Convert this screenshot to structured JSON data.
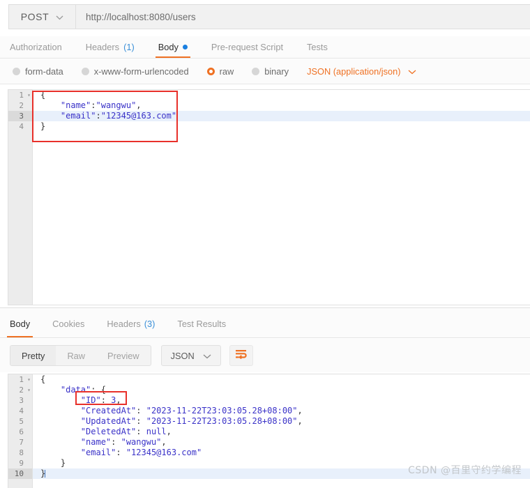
{
  "request": {
    "method": "POST",
    "method_caret_icon": "chevron-down-icon",
    "url": "http://localhost:8080/users",
    "tabs": [
      {
        "label": "Authorization",
        "count": "",
        "active": false,
        "dot": false
      },
      {
        "label": "Headers",
        "count": "(1)",
        "active": false,
        "dot": false
      },
      {
        "label": "Body",
        "count": "",
        "active": true,
        "dot": true
      },
      {
        "label": "Pre-request Script",
        "count": "",
        "active": false,
        "dot": false
      },
      {
        "label": "Tests",
        "count": "",
        "active": false,
        "dot": false
      }
    ],
    "body_types": [
      {
        "label": "form-data",
        "selected": false
      },
      {
        "label": "x-www-form-urlencoded",
        "selected": false
      },
      {
        "label": "raw",
        "selected": true
      },
      {
        "label": "binary",
        "selected": false
      }
    ],
    "content_type": "JSON (application/json)",
    "content_type_caret_icon": "chevron-down-icon",
    "body_lines": [
      {
        "n": "1",
        "fold": "▾",
        "text": "{",
        "highlight": false,
        "gutter_active": false
      },
      {
        "n": "2",
        "fold": "",
        "text": "    \"name\":\"wangwu\",",
        "highlight": false,
        "gutter_active": false
      },
      {
        "n": "3",
        "fold": "",
        "text": "    \"email\":\"12345@163.com\"",
        "highlight": true,
        "gutter_active": true
      },
      {
        "n": "4",
        "fold": "",
        "text": "}",
        "highlight": false,
        "gutter_active": false
      }
    ]
  },
  "response": {
    "tabs": [
      {
        "label": "Body",
        "count": "",
        "active": true
      },
      {
        "label": "Cookies",
        "count": "",
        "active": false
      },
      {
        "label": "Headers",
        "count": "(3)",
        "active": false
      },
      {
        "label": "Test Results",
        "count": "",
        "active": false
      }
    ],
    "view_modes": [
      {
        "label": "Pretty",
        "active": true
      },
      {
        "label": "Raw",
        "active": false
      },
      {
        "label": "Preview",
        "active": false
      }
    ],
    "format": "JSON",
    "format_caret_icon": "chevron-down-icon",
    "wrap_icon": "word-wrap-icon",
    "body_lines": [
      {
        "n": "1",
        "fold": "▾",
        "text": "{",
        "highlight": false,
        "gutter_active": false
      },
      {
        "n": "2",
        "fold": "▾",
        "text": "    \"data\": {",
        "highlight": false,
        "gutter_active": false
      },
      {
        "n": "3",
        "fold": "",
        "text": "        \"ID\": 3,",
        "highlight": false,
        "gutter_active": false
      },
      {
        "n": "4",
        "fold": "",
        "text": "        \"CreatedAt\": \"2023-11-22T23:03:05.28+08:00\",",
        "highlight": false,
        "gutter_active": false
      },
      {
        "n": "5",
        "fold": "",
        "text": "        \"UpdatedAt\": \"2023-11-22T23:03:05.28+08:00\",",
        "highlight": false,
        "gutter_active": false
      },
      {
        "n": "6",
        "fold": "",
        "text": "        \"DeletedAt\": null,",
        "highlight": false,
        "gutter_active": false
      },
      {
        "n": "7",
        "fold": "",
        "text": "        \"name\": \"wangwu\",",
        "highlight": false,
        "gutter_active": false
      },
      {
        "n": "8",
        "fold": "",
        "text": "        \"email\": \"12345@163.com\"",
        "highlight": false,
        "gutter_active": false
      },
      {
        "n": "9",
        "fold": "",
        "text": "    }",
        "highlight": false,
        "gutter_active": false
      },
      {
        "n": "10",
        "fold": "",
        "text": "}",
        "highlight": true,
        "gutter_active": true
      }
    ]
  },
  "annotations": {
    "request_box_label": "request-body-highlight-box",
    "response_box_label": "response-id-highlight-box",
    "accent_color": "#ef7123",
    "annotation_color": "#e8302a"
  },
  "watermark": "CSDN @百里守约学编程"
}
